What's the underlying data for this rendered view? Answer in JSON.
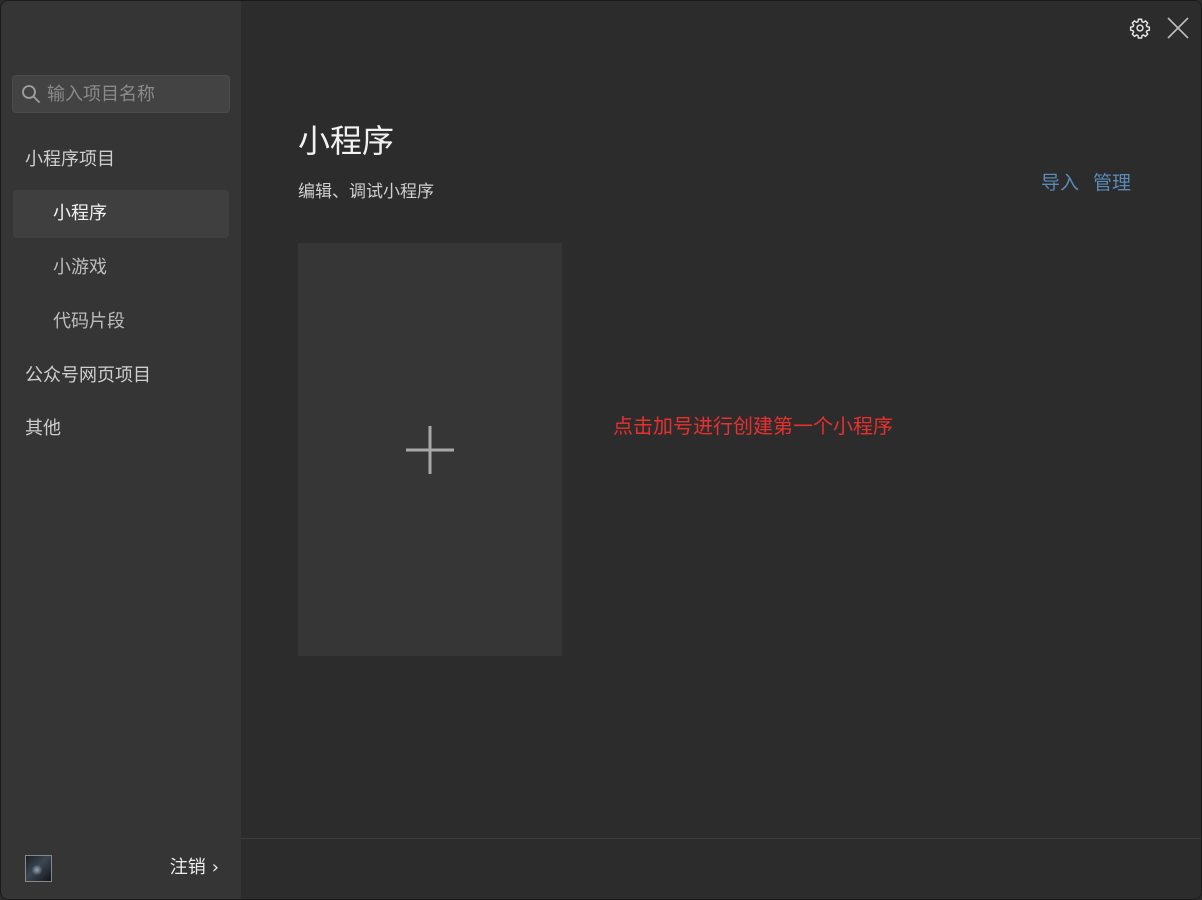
{
  "search": {
    "placeholder": "输入项目名称"
  },
  "sidebar": {
    "group_mini_program": "小程序项目",
    "items": [
      {
        "label": "小程序",
        "active": true
      },
      {
        "label": "小游戏",
        "active": false
      },
      {
        "label": "代码片段",
        "active": false
      }
    ],
    "group_web": "公众号网页项目",
    "group_other": "其他"
  },
  "footer": {
    "logout_label": "注销",
    "chevron": "›"
  },
  "main": {
    "title": "小程序",
    "subtitle": "编辑、调试小程序",
    "import_label": "导入",
    "manage_label": "管理",
    "hint": "点击加号进行创建第一个小程序"
  },
  "colors": {
    "sidebar_bg": "#353535",
    "main_bg": "#2c2c2c",
    "link": "#5a8ab5",
    "hint": "#e8302f"
  },
  "icons": {
    "search": "search-icon",
    "settings": "gear-icon",
    "close": "close-icon",
    "add": "plus-icon"
  }
}
